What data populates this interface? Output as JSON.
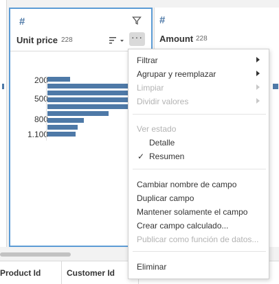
{
  "left_card": {},
  "unit_card": {
    "type_icon": "#",
    "title": "Unit price",
    "count": "228",
    "y_labels": [
      "200",
      "500",
      "800",
      "1.100"
    ],
    "bars": [
      0.22,
      0.86,
      0.86,
      0.86,
      0.86,
      0.59,
      0.35,
      0.29,
      0.27
    ],
    "bar_color": "#4e79a7"
  },
  "amount_card": {
    "type_icon": "#",
    "title": "Amount",
    "count": "228"
  },
  "table": {
    "columns": [
      "Product Id",
      "Customer Id"
    ]
  },
  "menu": {
    "items": [
      {
        "label": "Filtrar",
        "disabled": false,
        "submenu": true
      },
      {
        "label": "Agrupar y reemplazar",
        "disabled": false,
        "submenu": true
      },
      {
        "label": "Limpiar",
        "disabled": true,
        "submenu": true
      },
      {
        "label": "Dividir valores",
        "disabled": true,
        "submenu": true
      },
      {
        "label": "Ver estado",
        "disabled": true,
        "submenu": false
      },
      {
        "label": "Detalle",
        "disabled": false,
        "submenu": false
      },
      {
        "label": "Resumen",
        "disabled": false,
        "submenu": false,
        "checked": true
      },
      {
        "label": "Cambiar nombre de campo",
        "disabled": false,
        "submenu": false
      },
      {
        "label": "Duplicar campo",
        "disabled": false,
        "submenu": false
      },
      {
        "label": "Mantener solamente el campo",
        "disabled": false,
        "submenu": false
      },
      {
        "label": "Crear campo calculado...",
        "disabled": false,
        "submenu": false
      },
      {
        "label": "Publicar como función de datos...",
        "disabled": true,
        "submenu": false
      },
      {
        "label": "Eliminar",
        "disabled": false,
        "submenu": false
      }
    ],
    "check_mark": "✓"
  },
  "colors": {
    "accent": "#5b9bd5",
    "bar": "#4e79a7"
  }
}
